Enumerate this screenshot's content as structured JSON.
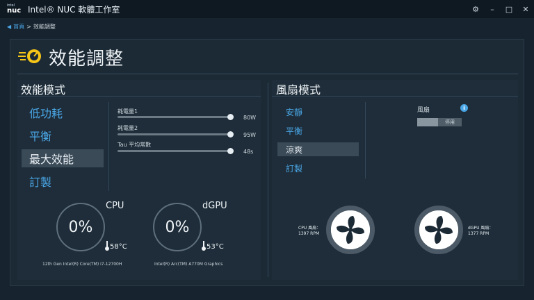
{
  "window": {
    "logo_line1": "intel",
    "logo_line2": "nuc",
    "title": "Intel® NUC 軟體工作室",
    "controls": {
      "settings": "⚙",
      "minimize": "–",
      "maximize": "□",
      "close": "✕"
    }
  },
  "breadcrumb": {
    "back": "◀",
    "home": "首頁",
    "separator": ">",
    "current": "效能調整"
  },
  "page": {
    "title": "效能調整"
  },
  "performance": {
    "heading": "效能模式",
    "modes": [
      {
        "label": "低功耗",
        "selected": false
      },
      {
        "label": "平衡",
        "selected": false
      },
      {
        "label": "最大效能",
        "selected": true
      },
      {
        "label": "訂製",
        "selected": false
      }
    ],
    "sliders": [
      {
        "label": "耗電量1",
        "value": "80W"
      },
      {
        "label": "耗電量2",
        "value": "95W"
      },
      {
        "label": "Tau 平均常數",
        "value": "48s"
      }
    ],
    "cpu": {
      "title": "CPU",
      "usage": "0%",
      "temp": "58°C",
      "name": "12th Gen Intel(R) Core(TM) i7-12700H"
    },
    "gpu": {
      "title": "dGPU",
      "usage": "0%",
      "temp": "53°C",
      "name": "Intel(R) Arc(TM) A770M Graphics"
    }
  },
  "fan": {
    "heading": "風扇模式",
    "modes": [
      {
        "label": "安靜",
        "selected": false
      },
      {
        "label": "平衡",
        "selected": false
      },
      {
        "label": "涼爽",
        "selected": true
      },
      {
        "label": "訂製",
        "selected": false
      }
    ],
    "toggle_label": "風扇",
    "toggle_state": "停用",
    "cpu_fan": {
      "label": "CPU 風扇：",
      "rpm": "1397 RPM"
    },
    "gpu_fan": {
      "label": "dGPU 風扇：",
      "rpm": "1377 RPM"
    }
  },
  "colors": {
    "accent": "#4aa6e6",
    "background": "#17232e",
    "panel": "#1c2a36"
  }
}
